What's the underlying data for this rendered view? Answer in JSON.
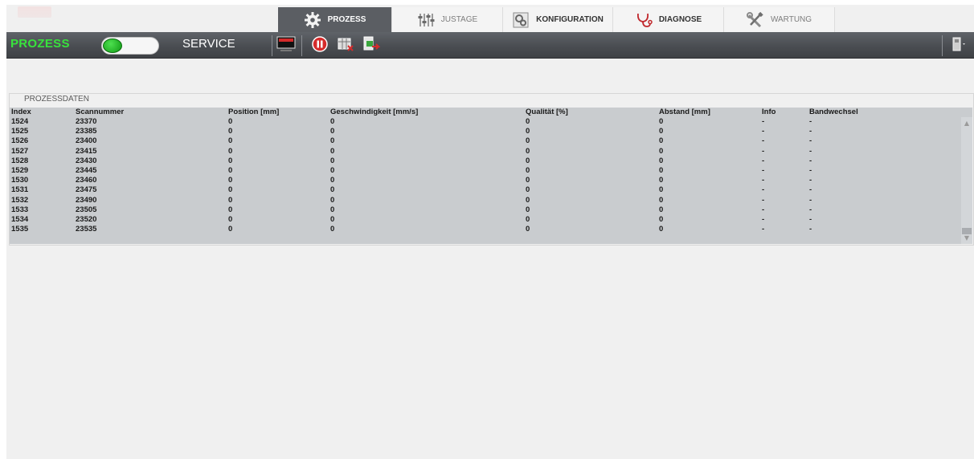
{
  "tabs": [
    {
      "label": "PROZESS",
      "icon": "gear-icon"
    },
    {
      "label": "JUSTAGE",
      "icon": "sliders-icon"
    },
    {
      "label": "KONFIGURATION",
      "icon": "config-gears-icon"
    },
    {
      "label": "DIAGNOSE",
      "icon": "stethoscope-icon"
    },
    {
      "label": "WARTUNG",
      "icon": "wrench-screwdriver-icon"
    }
  ],
  "toolbar": {
    "mode_label": "PROZESS",
    "service_label": "SERVICE",
    "mode_switch_state": "on",
    "buttons": [
      "display-icon",
      "pause-icon",
      "clear-table-icon",
      "export-icon"
    ],
    "right_button": "device-menu-icon"
  },
  "group": {
    "title": "PROZESSDATEN",
    "columns": [
      "Index",
      "Scannummer",
      "Position [mm]",
      "Geschwindigkeit [mm/s]",
      "Qualität [%]",
      "Abstand [mm]",
      "Info",
      "Bandwechsel"
    ],
    "rows": [
      [
        "1524",
        "23370",
        "0",
        "0",
        "0",
        "0",
        "-",
        "-"
      ],
      [
        "1525",
        "23385",
        "0",
        "0",
        "0",
        "0",
        "-",
        "-"
      ],
      [
        "1526",
        "23400",
        "0",
        "0",
        "0",
        "0",
        "-",
        "-"
      ],
      [
        "1527",
        "23415",
        "0",
        "0",
        "0",
        "0",
        "-",
        "-"
      ],
      [
        "1528",
        "23430",
        "0",
        "0",
        "0",
        "0",
        "-",
        "-"
      ],
      [
        "1529",
        "23445",
        "0",
        "0",
        "0",
        "0",
        "-",
        "-"
      ],
      [
        "1530",
        "23460",
        "0",
        "0",
        "0",
        "0",
        "-",
        "-"
      ],
      [
        "1531",
        "23475",
        "0",
        "0",
        "0",
        "0",
        "-",
        "-"
      ],
      [
        "1532",
        "23490",
        "0",
        "0",
        "0",
        "0",
        "-",
        "-"
      ],
      [
        "1533",
        "23505",
        "0",
        "0",
        "0",
        "0",
        "-",
        "-"
      ],
      [
        "1534",
        "23520",
        "0",
        "0",
        "0",
        "0",
        "-",
        "-"
      ],
      [
        "1535",
        "23535",
        "0",
        "0",
        "0",
        "0",
        "-",
        "-"
      ]
    ]
  },
  "colors": {
    "accent_green": "#38e23c",
    "toolbar_dark": "#4a4d52",
    "active_tab": "#5b5e63",
    "grid_background": "#c9cccf"
  }
}
